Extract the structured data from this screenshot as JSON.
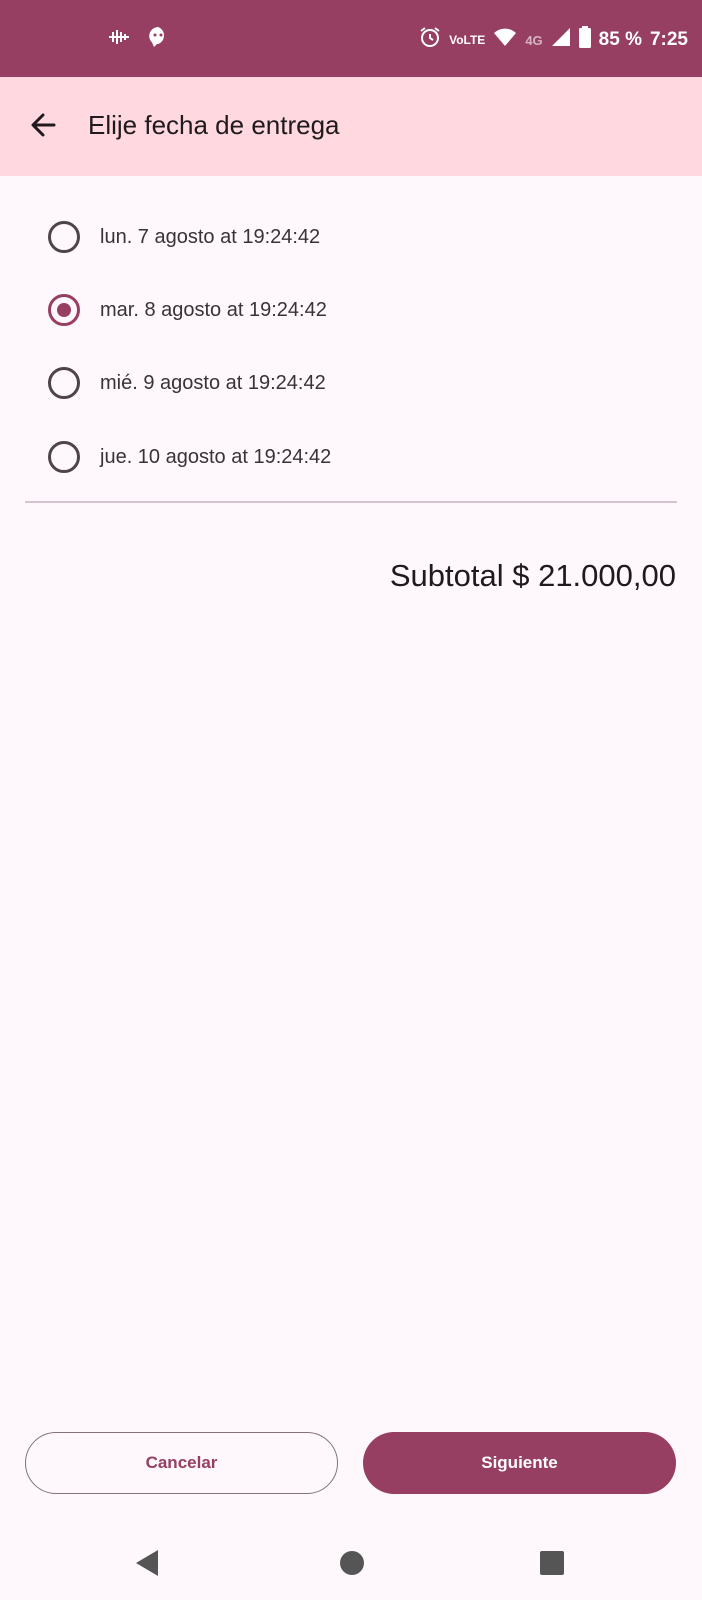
{
  "status_bar": {
    "battery": "85 %",
    "time": "7:25",
    "network": "4G",
    "volte": "VoLTE",
    "icons": [
      "audio-wave-icon",
      "chat-bubble-icon",
      "alarm-icon",
      "volte-icon",
      "wifi-icon",
      "signal-icon",
      "battery-icon"
    ]
  },
  "app_bar": {
    "title": "Elije fecha de entrega",
    "back_icon": "arrow-back-icon"
  },
  "options": [
    {
      "label": "lun. 7 agosto at 19:24:42",
      "selected": false
    },
    {
      "label": "mar. 8 agosto at 19:24:42",
      "selected": true
    },
    {
      "label": "mié. 9 agosto at 19:24:42",
      "selected": false
    },
    {
      "label": "jue. 10 agosto at 19:24:42",
      "selected": false
    }
  ],
  "subtotal": "Subtotal $ 21.000,00",
  "buttons": {
    "cancel": "Cancelar",
    "next": "Siguiente"
  },
  "colors": {
    "primary": "#963f62",
    "app_bar_bg": "#ffd8e0",
    "background": "#fef7fb"
  },
  "nav_bar": [
    "nav-back-icon",
    "nav-home-icon",
    "nav-recents-icon"
  ]
}
